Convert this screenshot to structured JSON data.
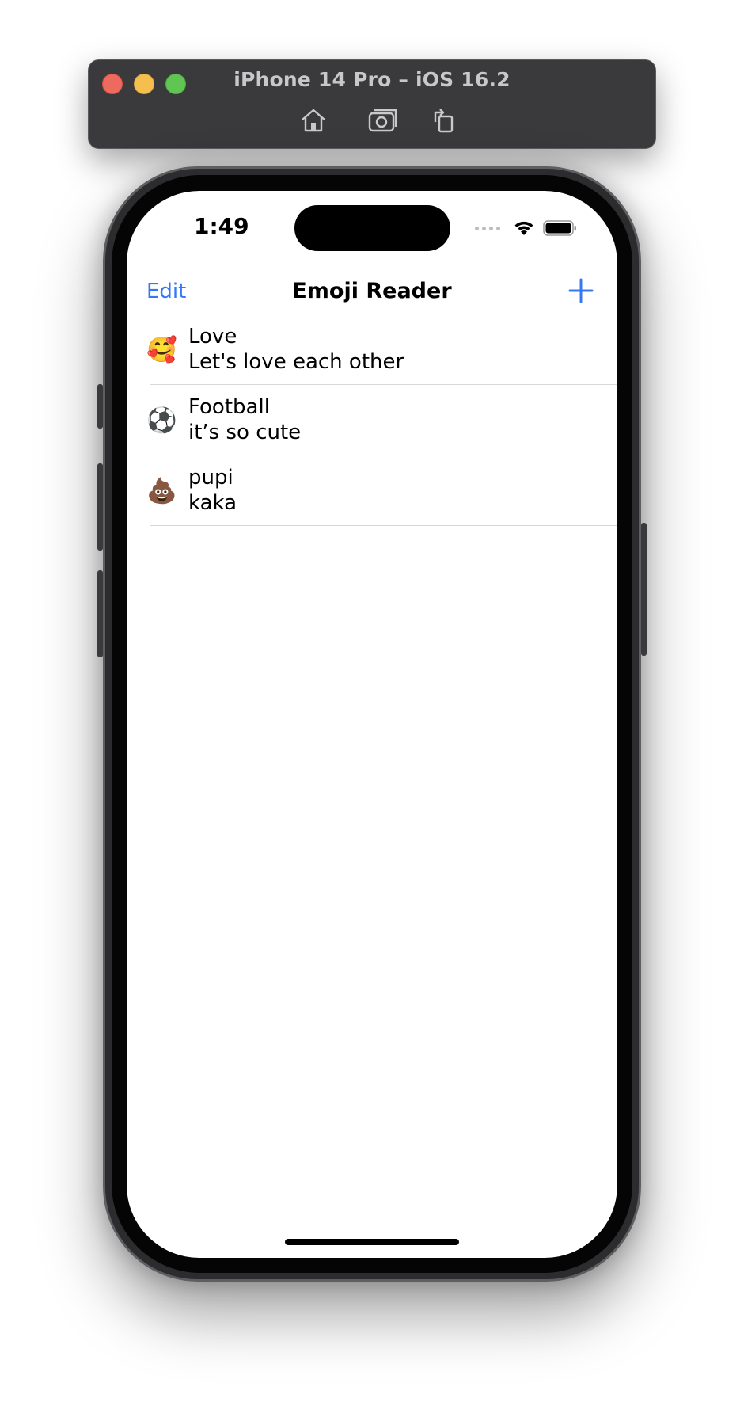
{
  "simulator": {
    "title": "iPhone 14 Pro – iOS 16.2",
    "tools": {
      "home": "home-icon",
      "screenshot": "camera-icon",
      "rotate": "rotate-icon"
    }
  },
  "status_bar": {
    "time": "1:49"
  },
  "navbar": {
    "edit_label": "Edit",
    "title": "Emoji Reader",
    "add_icon": "plus-icon",
    "accent_color": "#3478f6"
  },
  "list": {
    "items": [
      {
        "emoji": "🥰",
        "title": "Love",
        "subtitle": "Let's love each other"
      },
      {
        "emoji": "⚽",
        "title": "Football",
        "subtitle": "it’s so cute"
      },
      {
        "emoji": "💩",
        "title": "pupi",
        "subtitle": "kaka"
      }
    ]
  }
}
